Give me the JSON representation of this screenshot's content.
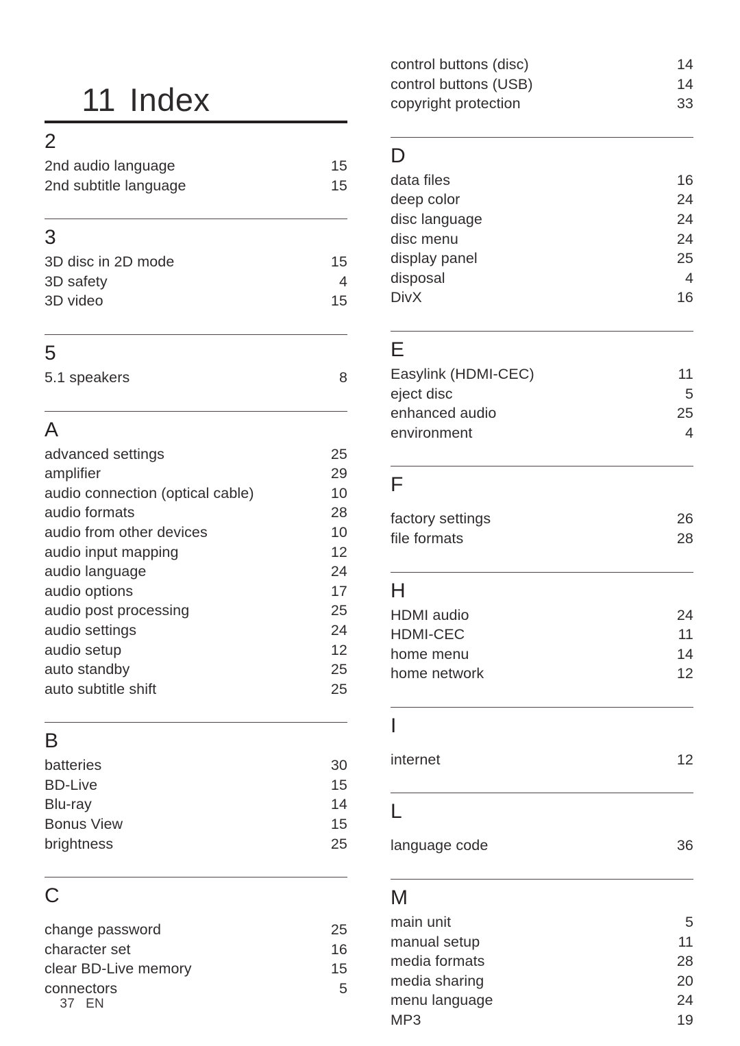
{
  "title": {
    "number": "11",
    "text": "Index"
  },
  "footer": {
    "page_number": "37",
    "language": "EN"
  },
  "columns": {
    "left": [
      {
        "rule": "thick",
        "heading": "2",
        "wide_head": false,
        "entries": [
          {
            "label": "2nd audio language",
            "page": "15"
          },
          {
            "label": "2nd subtitle language",
            "page": "15"
          }
        ]
      },
      {
        "rule": "thin",
        "heading": "3",
        "wide_head": false,
        "entries": [
          {
            "label": "3D disc in 2D mode",
            "page": "15"
          },
          {
            "label": "3D safety",
            "page": "4"
          },
          {
            "label": "3D video",
            "page": "15"
          }
        ]
      },
      {
        "rule": "thin",
        "heading": "5",
        "wide_head": false,
        "entries": [
          {
            "label": "5.1 speakers",
            "page": "8"
          }
        ]
      },
      {
        "rule": "thin",
        "heading": "A",
        "wide_head": false,
        "entries": [
          {
            "label": "advanced settings",
            "page": "25"
          },
          {
            "label": "amplifier",
            "page": "29"
          },
          {
            "label": "audio connection (optical cable)",
            "page": "10"
          },
          {
            "label": "audio formats",
            "page": "28"
          },
          {
            "label": "audio from other devices",
            "page": "10"
          },
          {
            "label": "audio input mapping",
            "page": "12"
          },
          {
            "label": "audio language",
            "page": "24"
          },
          {
            "label": "audio options",
            "page": "17"
          },
          {
            "label": "audio post processing",
            "page": "25"
          },
          {
            "label": "audio settings",
            "page": "24"
          },
          {
            "label": "audio setup",
            "page": "12"
          },
          {
            "label": "auto standby",
            "page": "25"
          },
          {
            "label": "auto subtitle shift",
            "page": "25"
          }
        ]
      },
      {
        "rule": "thin",
        "heading": "B",
        "wide_head": false,
        "entries": [
          {
            "label": "batteries",
            "page": "30"
          },
          {
            "label": "BD-Live",
            "page": "15"
          },
          {
            "label": "Blu-ray",
            "page": "14"
          },
          {
            "label": "Bonus View",
            "page": "15"
          },
          {
            "label": "brightness",
            "page": "25"
          }
        ]
      },
      {
        "rule": "thin",
        "heading": "C",
        "wide_head": true,
        "entries": [
          {
            "label": "change password",
            "page": "25"
          },
          {
            "label": "character set",
            "page": "16"
          },
          {
            "label": "clear BD-Live memory",
            "page": "15"
          },
          {
            "label": "connectors",
            "page": "5"
          }
        ]
      }
    ],
    "right": [
      {
        "rule": "none",
        "heading": "",
        "wide_head": false,
        "entries": [
          {
            "label": "control buttons (disc)",
            "page": "14"
          },
          {
            "label": "control buttons (USB)",
            "page": "14"
          },
          {
            "label": "copyright protection",
            "page": "33"
          }
        ]
      },
      {
        "rule": "thin",
        "heading": "D",
        "wide_head": false,
        "entries": [
          {
            "label": "data files",
            "page": "16"
          },
          {
            "label": "deep color",
            "page": "24"
          },
          {
            "label": "disc language",
            "page": "24"
          },
          {
            "label": "disc menu",
            "page": "24"
          },
          {
            "label": "display panel",
            "page": "25"
          },
          {
            "label": "disposal",
            "page": "4"
          },
          {
            "label": "DivX",
            "page": "16"
          }
        ]
      },
      {
        "rule": "thin",
        "heading": "E",
        "wide_head": false,
        "entries": [
          {
            "label": "Easylink (HDMI-CEC)",
            "page": "11"
          },
          {
            "label": "eject disc",
            "page": "5"
          },
          {
            "label": "enhanced audio",
            "page": "25"
          },
          {
            "label": "environment",
            "page": "4"
          }
        ]
      },
      {
        "rule": "thin",
        "heading": "F",
        "wide_head": true,
        "entries": [
          {
            "label": "factory settings",
            "page": "26"
          },
          {
            "label": "file formats",
            "page": "28"
          }
        ]
      },
      {
        "rule": "thin",
        "heading": "H",
        "wide_head": false,
        "entries": [
          {
            "label": "HDMI audio",
            "page": "24"
          },
          {
            "label": "HDMI-CEC",
            "page": "11"
          },
          {
            "label": "home menu",
            "page": "14"
          },
          {
            "label": "home network",
            "page": "12"
          }
        ]
      },
      {
        "rule": "thin",
        "heading": "I",
        "wide_head": true,
        "entries": [
          {
            "label": "internet",
            "page": "12"
          }
        ]
      },
      {
        "rule": "thin",
        "heading": "L",
        "wide_head": true,
        "entries": [
          {
            "label": "language code",
            "page": "36"
          }
        ]
      },
      {
        "rule": "thin",
        "heading": "M",
        "wide_head": false,
        "entries": [
          {
            "label": "main unit",
            "page": "5"
          },
          {
            "label": "manual setup",
            "page": "11"
          },
          {
            "label": "media formats",
            "page": "28"
          },
          {
            "label": "media sharing",
            "page": "20"
          },
          {
            "label": "menu language",
            "page": "24"
          },
          {
            "label": "MP3",
            "page": "19"
          }
        ]
      }
    ]
  }
}
